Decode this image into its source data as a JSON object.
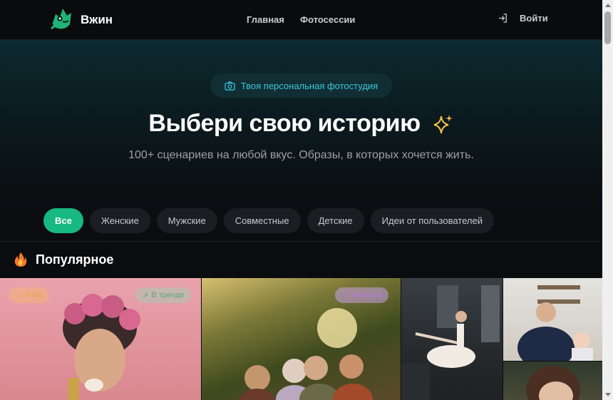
{
  "header": {
    "brand": "Вжин",
    "nav": {
      "home": "Главная",
      "photoshoots": "Фотосессии"
    },
    "login_label": "Войти"
  },
  "hero": {
    "badge": "Твоя персональная фотостудия",
    "title": "Выбери свою историю",
    "subtitle": "100+ сценариев на любой вкус. Образы, в которых хочется жить."
  },
  "filters": [
    "Все",
    "Женские",
    "Мужские",
    "Совместные",
    "Детские",
    "Идеи от пользователей"
  ],
  "popular": {
    "title": "Популярное",
    "tags": {
      "pro": "PRO",
      "trend": "В тренде",
      "new": "Новинка"
    }
  },
  "icons": {
    "logo": "frog-logo-icon",
    "login": "log-in-icon",
    "badge": "camera-icon",
    "title": "sparkles-icon",
    "section": "flame-icon"
  },
  "colors": {
    "accent": "#18b882",
    "badge_text": "#39c7d8",
    "sparkle": "#f5c24a",
    "background": "#0b0c10"
  }
}
